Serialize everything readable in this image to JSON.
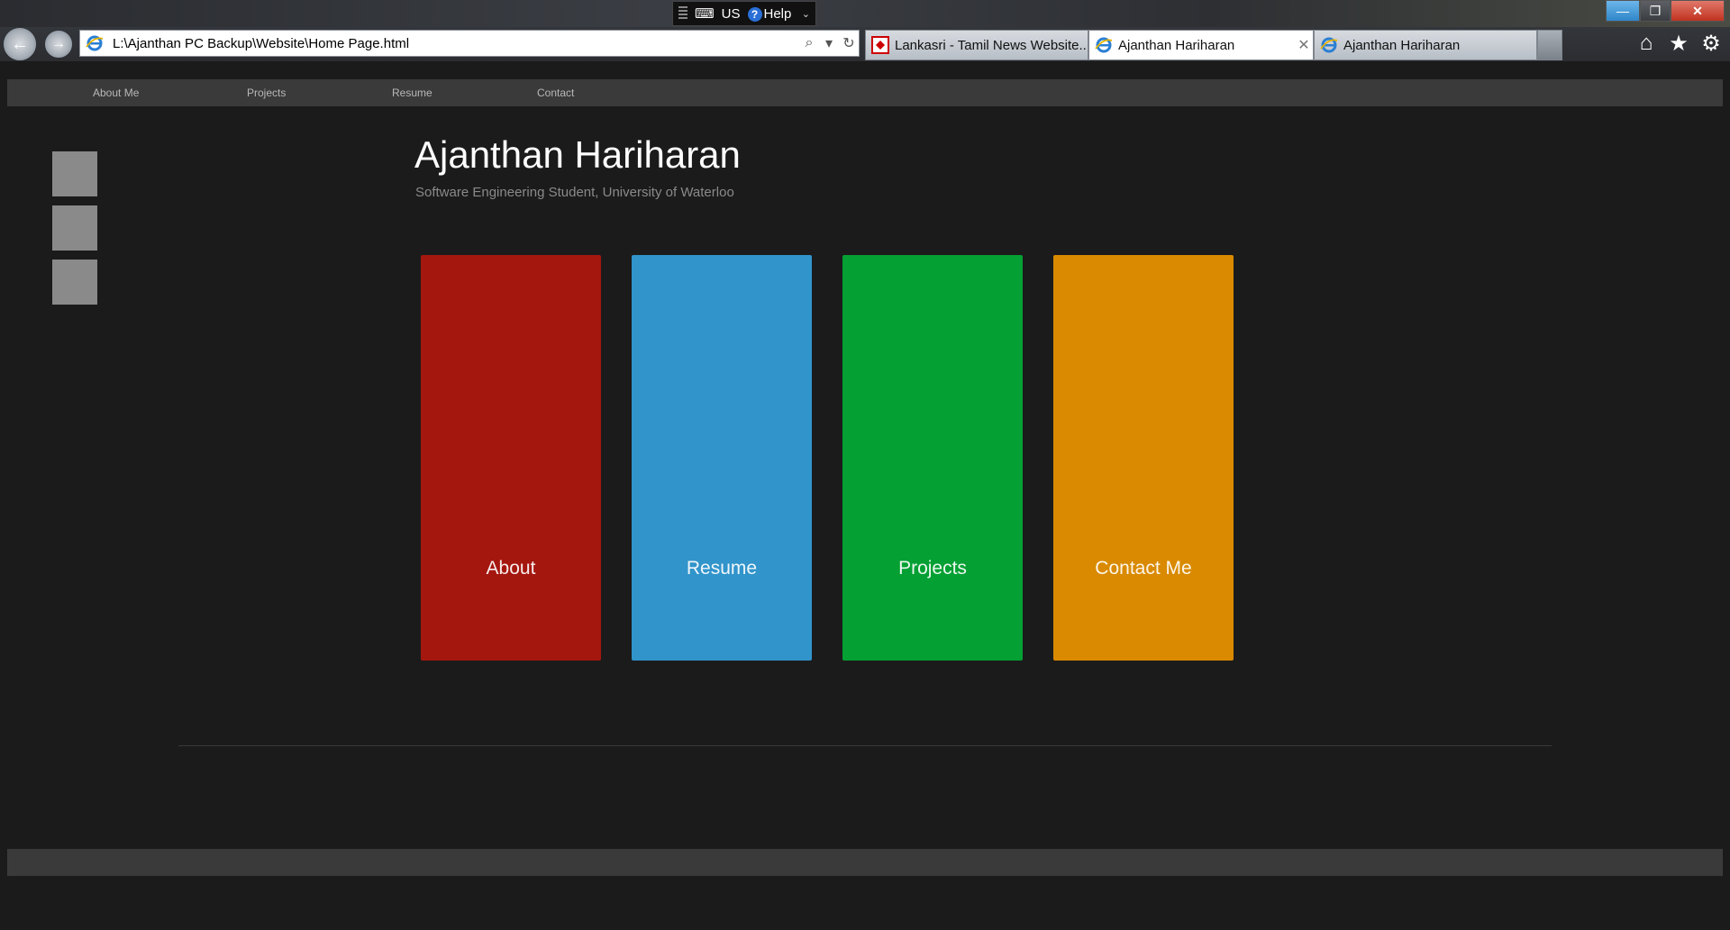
{
  "browser": {
    "ime": {
      "language": "US",
      "help": "Help"
    },
    "address_url": "L:\\Ajanthan PC Backup\\Website\\Home Page.html",
    "tabs": [
      {
        "label": "Lankasri - Tamil News Website...",
        "icon": "lankasri-favicon"
      },
      {
        "label": "Ajanthan Hariharan",
        "icon": "ie-icon",
        "active": true
      },
      {
        "label": "Ajanthan Hariharan",
        "icon": "ie-icon"
      }
    ],
    "window_controls": {
      "minimize": "—",
      "maximize": "❐",
      "close": "✕"
    },
    "tool_icons": [
      "home-icon",
      "star-icon",
      "gear-icon"
    ]
  },
  "site": {
    "nav": [
      "About Me",
      "Projects",
      "Resume",
      "Contact"
    ],
    "title": "Ajanthan Hariharan",
    "subtitle": "Software Engineering Student, University of Waterloo",
    "tiles": [
      {
        "label": "About",
        "color": "#a4170f"
      },
      {
        "label": "Resume",
        "color": "#3194cb"
      },
      {
        "label": "Projects",
        "color": "#04a033"
      },
      {
        "label": "Contact Me",
        "color": "#d98a00"
      }
    ],
    "colors": {
      "background": "#1b1b1b",
      "bar": "#3a3a3a",
      "social_placeholder": "#8a8a8a"
    }
  }
}
